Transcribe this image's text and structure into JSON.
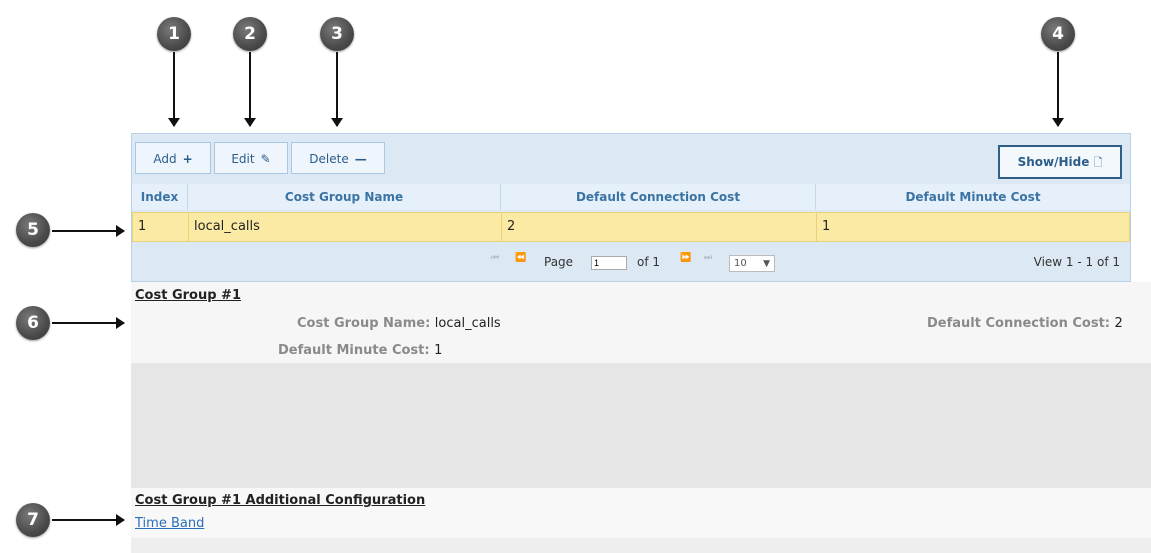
{
  "callouts": [
    "1",
    "2",
    "3",
    "4",
    "5",
    "6",
    "7"
  ],
  "toolbar": {
    "add_label": "Add",
    "add_icon": "+",
    "edit_label": "Edit",
    "edit_icon": "✎",
    "delete_label": "Delete",
    "delete_icon": "—",
    "showhide_label": "Show/Hide",
    "showhide_icon": "🗋"
  },
  "table": {
    "columns": [
      "Index",
      "Cost Group Name",
      "Default Connection Cost",
      "Default Minute Cost"
    ],
    "rows": [
      [
        "1",
        "local_calls",
        "2",
        "1"
      ]
    ]
  },
  "pager": {
    "page_label": "Page",
    "page_value": "1",
    "of_label": "of 1",
    "per_page": "10",
    "view_text": "View 1 - 1 of 1"
  },
  "detail": {
    "title": "Cost Group #1",
    "name_label": "Cost Group Name:",
    "name_value": "local_calls",
    "conn_label": "Default Connection Cost:",
    "conn_value": "2",
    "minute_label": "Default Minute Cost:",
    "minute_value": "1"
  },
  "additional": {
    "title": "Cost Group #1 Additional Configuration",
    "link": "Time Band"
  },
  "colors": {
    "selected_row": "#fbeaa3",
    "header_text": "#3b73a3",
    "link": "#2a6ebb"
  }
}
